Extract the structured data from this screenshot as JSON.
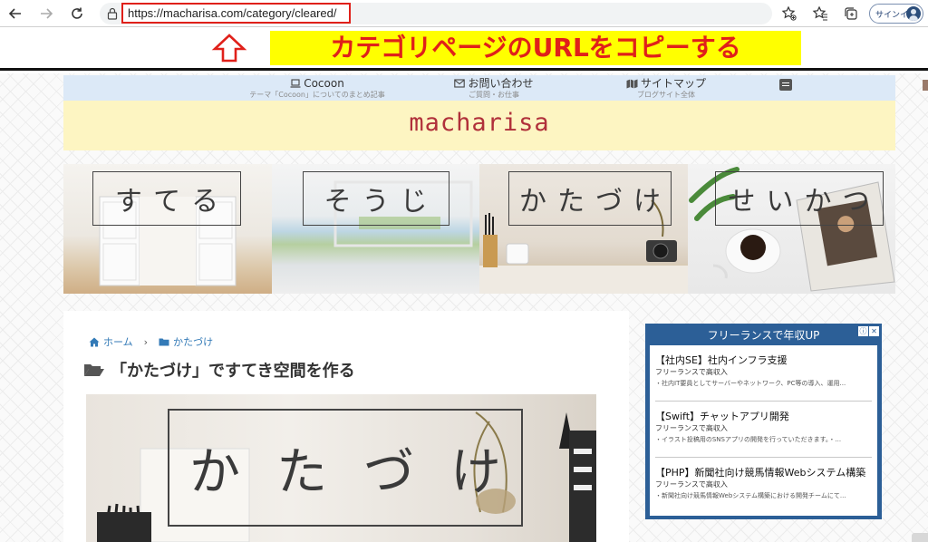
{
  "browser": {
    "url": "https://macharisa.com/category/cleared/",
    "signin_label": "サインイン",
    "icons": [
      "back-arrow-icon",
      "forward-arrow-icon",
      "reload-icon",
      "lock-icon",
      "site-favorite-icon",
      "favorites-icon",
      "collections-icon",
      "profile-avatar-icon"
    ]
  },
  "annotation": {
    "label": "カテゴリページのURLをコピーする",
    "colors": {
      "text": "#e0201a",
      "background": "#ffff00",
      "highlight_border": "#e0201a"
    }
  },
  "site_nav": {
    "items": [
      {
        "title": "Cocoon",
        "sub": "テーマ「Cocoon」についてのまとめ記事",
        "icon": "laptop-icon"
      },
      {
        "title": "お問い合わせ",
        "sub": "ご質問・お仕事",
        "icon": "mail-icon"
      },
      {
        "title": "サイトマップ",
        "sub": "ブログサイト全体",
        "icon": "map-icon"
      }
    ]
  },
  "header": {
    "logo": "macharisa"
  },
  "banners": [
    {
      "label": "すてる"
    },
    {
      "label": "そうじ"
    },
    {
      "label": "かたづけ"
    },
    {
      "label": "せいかつ"
    }
  ],
  "main": {
    "breadcrumb": {
      "home": "ホーム",
      "current": "かたづけ"
    },
    "title": "「かたづけ」ですてき空間を作る",
    "eyecatch_label": "かたづけ"
  },
  "ad": {
    "title": "フリーランスで年収UP",
    "items": [
      {
        "headline": "【社内SE】社内インフラ支援",
        "sub": "フリーランスで高収入",
        "desc": "・社内IT要員としてサーバーやネットワーク、PC等の導入、運用..."
      },
      {
        "headline": "【Swift】チャットアプリ開発",
        "sub": "フリーランスで高収入",
        "desc": "・イラスト投稿用のSNSアプリの開発を行っていただきます。・..."
      },
      {
        "headline": "【PHP】新聞社向け競馬情報Webシステム構築",
        "sub": "フリーランスで高収入",
        "desc": "・新聞社向け競馬情報Webシステム構築における開発チームにて..."
      }
    ]
  }
}
